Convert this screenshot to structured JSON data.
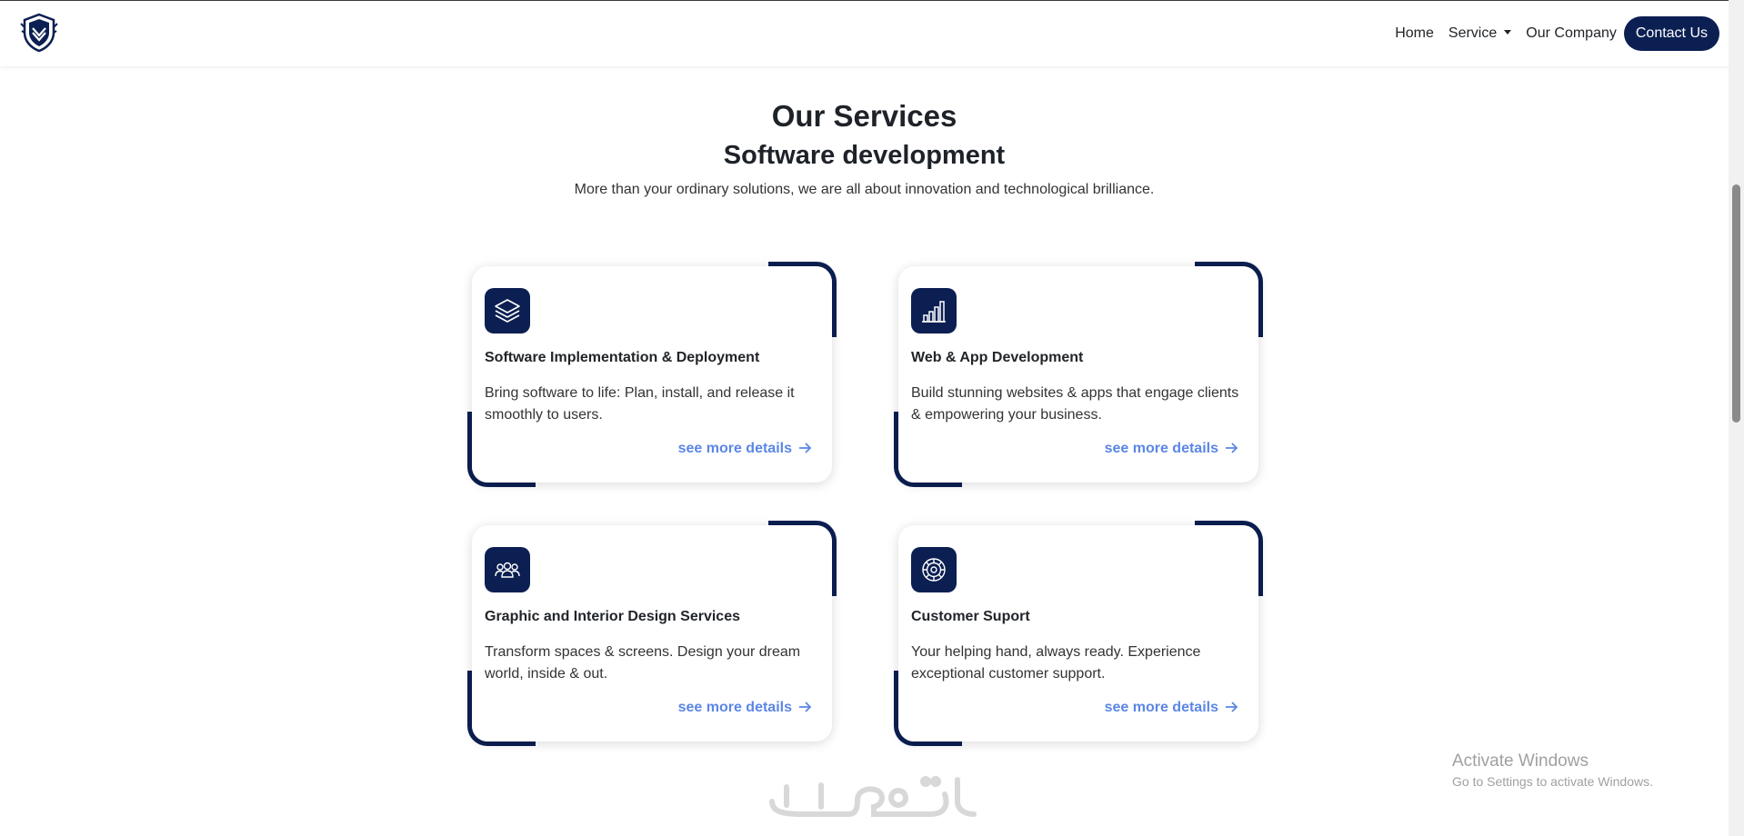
{
  "nav": {
    "home": "Home",
    "service": "Service",
    "company": "Our Company",
    "contact": "Contact Us"
  },
  "section": {
    "title": "Our Services",
    "subtitle": "Software development",
    "description": "More than your ordinary solutions, we are all about innovation and technological brilliance."
  },
  "cards": [
    {
      "icon": "layers-icon",
      "title": "Software Implementation & Deployment",
      "text": "Bring software to life: Plan, install, and release it smoothly to users.",
      "link": "see more details"
    },
    {
      "icon": "bar-chart-icon",
      "title": "Web & App Development",
      "text": "Build stunning websites & apps that engage clients & empowering your business.",
      "link": "see more details"
    },
    {
      "icon": "people-icon",
      "title": "Graphic and Interior Design Services",
      "text": "Transform spaces & screens. Design your dream world, inside & out.",
      "link": "see more details"
    },
    {
      "icon": "support-gear-icon",
      "title": "Customer Suport",
      "text": "Your helping hand, always ready. Experience exceptional customer support.",
      "link": "see more details"
    }
  ],
  "watermark": "خمسات",
  "windows_notice": {
    "title": "Activate Windows",
    "text": "Go to Settings to activate Windows."
  },
  "colors": {
    "brand_navy": "#0b1f52",
    "link_blue": "#5b86e5"
  }
}
